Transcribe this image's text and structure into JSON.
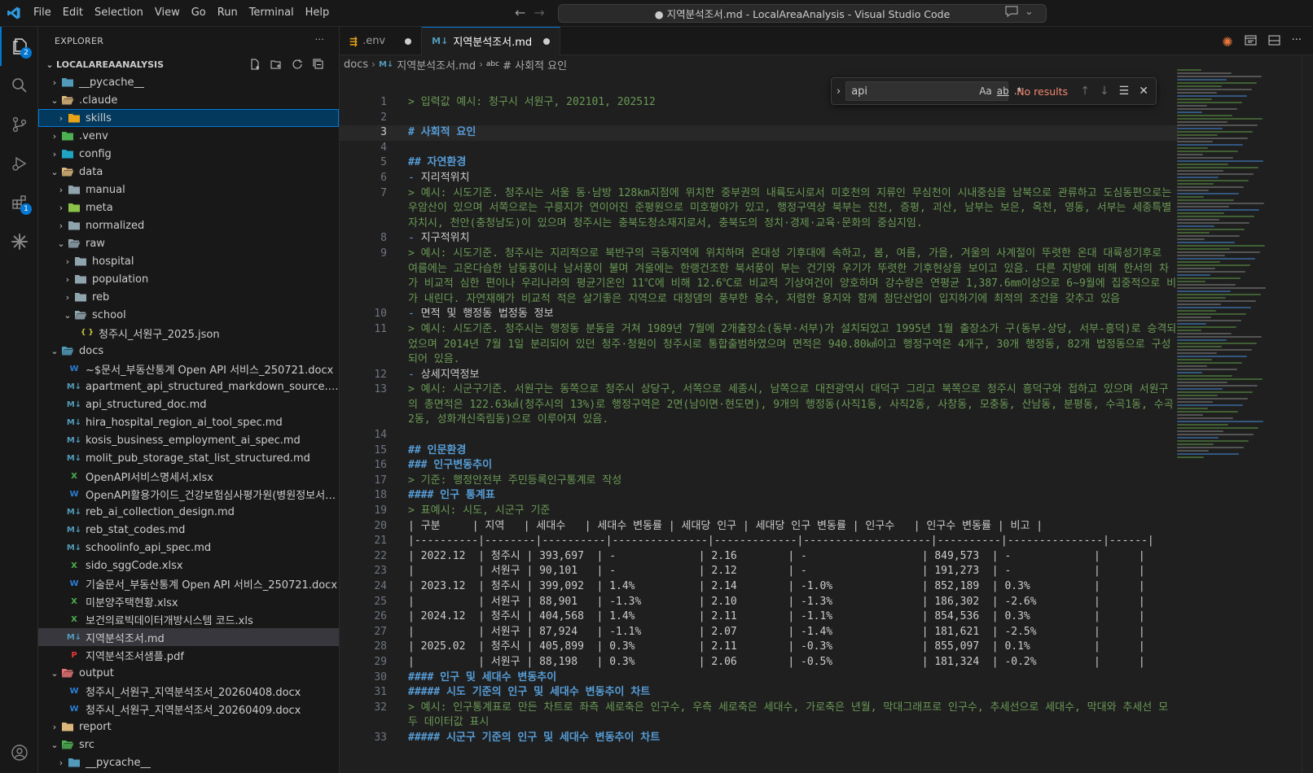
{
  "menu": [
    "File",
    "Edit",
    "Selection",
    "View",
    "Go",
    "Run",
    "Terminal",
    "Help"
  ],
  "window_title": "● 지역분석조서.md - LocalAreaAnalysis - Visual Studio Code",
  "activity": {
    "explorer_badge": "2",
    "extensions_badge": "1"
  },
  "explorer": {
    "header": "EXPLORER",
    "root": "LOCALAREAANALYSIS",
    "rows": [
      {
        "label": "__pycache__",
        "depth": 0,
        "type": "folder",
        "open": false,
        "color": "#519aba"
      },
      {
        "label": ".claude",
        "depth": 0,
        "type": "folder",
        "open": true,
        "color": "#dcb67a"
      },
      {
        "label": "skills",
        "depth": 1,
        "type": "folder",
        "open": false,
        "color": "#e8a317",
        "selected": true
      },
      {
        "label": ".venv",
        "depth": 0,
        "type": "folder",
        "open": false,
        "color": "#4caf50"
      },
      {
        "label": "config",
        "depth": 0,
        "type": "folder",
        "open": false,
        "color": "#20a4c4"
      },
      {
        "label": "data",
        "depth": 0,
        "type": "folder",
        "open": true,
        "color": "#dcb67a"
      },
      {
        "label": "manual",
        "depth": 1,
        "type": "folder",
        "open": false,
        "color": "#90a4ae"
      },
      {
        "label": "meta",
        "depth": 1,
        "type": "folder",
        "open": false,
        "color": "#8bc34a"
      },
      {
        "label": "normalized",
        "depth": 1,
        "type": "folder",
        "open": false,
        "color": "#90a4ae"
      },
      {
        "label": "raw",
        "depth": 1,
        "type": "folder",
        "open": true,
        "color": "#90a4ae"
      },
      {
        "label": "hospital",
        "depth": 2,
        "type": "folder",
        "open": false,
        "color": "#90a4ae"
      },
      {
        "label": "population",
        "depth": 2,
        "type": "folder",
        "open": false,
        "color": "#90a4ae"
      },
      {
        "label": "reb",
        "depth": 2,
        "type": "folder",
        "open": false,
        "color": "#90a4ae"
      },
      {
        "label": "school",
        "depth": 2,
        "type": "folder",
        "open": true,
        "color": "#90a4ae"
      },
      {
        "label": "청주시_서원구_2025.json",
        "depth": 3,
        "type": "json"
      },
      {
        "label": "docs",
        "depth": 0,
        "type": "folder",
        "open": true,
        "color": "#519aba"
      },
      {
        "label": "~$문서_부동산통계 Open API 서비스_250721.docx",
        "depth": 1,
        "type": "docx"
      },
      {
        "label": "apartment_api_structured_markdown_source.md",
        "depth": 1,
        "type": "md"
      },
      {
        "label": "api_structured_doc.md",
        "depth": 1,
        "type": "md"
      },
      {
        "label": "hira_hospital_region_ai_tool_spec.md",
        "depth": 1,
        "type": "md"
      },
      {
        "label": "kosis_business_employment_ai_spec.md",
        "depth": 1,
        "type": "md"
      },
      {
        "label": "molit_pub_storage_stat_list_structured.md",
        "depth": 1,
        "type": "md"
      },
      {
        "label": "OpenAPI서비스명세서.xlsx",
        "depth": 1,
        "type": "xlsx"
      },
      {
        "label": "OpenAPI활용가이드_건강보험심사평가원(병원정보서비...",
        "depth": 1,
        "type": "docx"
      },
      {
        "label": "reb_ai_collection_design.md",
        "depth": 1,
        "type": "md"
      },
      {
        "label": "reb_stat_codes.md",
        "depth": 1,
        "type": "md"
      },
      {
        "label": "schoolinfo_api_spec.md",
        "depth": 1,
        "type": "md"
      },
      {
        "label": "sido_sggCode.xlsx",
        "depth": 1,
        "type": "xlsx"
      },
      {
        "label": "기술문서_부동산통계 Open API 서비스_250721.docx",
        "depth": 1,
        "type": "docx"
      },
      {
        "label": "미분양주택현황.xlsx",
        "depth": 1,
        "type": "xlsx"
      },
      {
        "label": "보건의료빅데이터개방시스템 코드.xls",
        "depth": 1,
        "type": "xlsx"
      },
      {
        "label": "지역분석조서.md",
        "depth": 1,
        "type": "md",
        "current": true
      },
      {
        "label": "지역분석조서샘플.pdf",
        "depth": 1,
        "type": "pdf"
      },
      {
        "label": "output",
        "depth": 0,
        "type": "folder",
        "open": true,
        "color": "#e57373"
      },
      {
        "label": "청주시_서원구_지역분석조서_20260408.docx",
        "depth": 1,
        "type": "docx"
      },
      {
        "label": "청주시_서원구_지역분석조서_20260409.docx",
        "depth": 1,
        "type": "docx"
      },
      {
        "label": "report",
        "depth": 0,
        "type": "folder",
        "open": false,
        "color": "#dcb67a"
      },
      {
        "label": "src",
        "depth": 0,
        "type": "folder",
        "open": true,
        "color": "#4caf50"
      },
      {
        "label": "__pycache__",
        "depth": 1,
        "type": "folder",
        "open": false,
        "color": "#519aba"
      }
    ]
  },
  "tabs": [
    {
      "label": ".env",
      "icon": "env",
      "active": false,
      "dirty": true
    },
    {
      "label": "지역분석조서.md",
      "icon": "md",
      "active": true,
      "dirty": true
    }
  ],
  "breadcrumb": [
    "docs",
    "지역분석조서.md",
    "# 사회적 요인"
  ],
  "find": {
    "value": "api",
    "status": "No results"
  },
  "code_lines": [
    {
      "n": "1",
      "parts": [
        [
          "q",
          "> 입력값 예시: 청구시 서원구, 202101, 202512"
        ]
      ]
    },
    {
      "n": "2",
      "parts": [
        [
          "p",
          ""
        ]
      ]
    },
    {
      "n": "3",
      "parts": [
        [
          "h",
          "# 사회적 요인"
        ]
      ],
      "current": true
    },
    {
      "n": "4",
      "parts": [
        [
          "p",
          ""
        ]
      ]
    },
    {
      "n": "5",
      "parts": [
        [
          "h",
          "## 자연환경"
        ]
      ]
    },
    {
      "n": "6",
      "parts": [
        [
          "b",
          "- "
        ],
        [
          "p",
          "지리적위치"
        ]
      ]
    },
    {
      "n": "7",
      "parts": [
        [
          "q",
          "> 예시: 시도기준. 청주시는 서울 동·남방 128km지점에 위치한 중부권의 내륙도시로서 미호천의 지류인 무심천이 시내중심을 남북으로 관류하고 도심동편으로는 우암산이 있으며 서쪽으로는 구릉지가 연이어진 준평원으로 미호평야가 있고, 행정구역상 북부는 진천, 증평, 괴산, 남부는 보은, 옥천, 영동, 서부는 세종특별자치시, 천안(충청남도)이 있으며 청주시는 충북도청소재지로서, 충북도의 정치·경제·교육·문화의 중심지임."
        ]
      ]
    },
    {
      "n": "8",
      "parts": [
        [
          "b",
          "- "
        ],
        [
          "p",
          "지구적위치"
        ]
      ]
    },
    {
      "n": "9",
      "parts": [
        [
          "q",
          "> 예시: 시도기준. 청주시는 지리적으로 북반구의 극동지역에 위치하며 온대성 기후대에 속하고, 봄, 여름, 가을, 겨울의 사계절이 뚜렷한 온대 대륙성기후로 여름에는 고온다습한 남동풍이나 남서풍이 불며 겨울에는 한랭건조한 북서풍이 부는 건기와 우기가 뚜렷한 기후현상을 보이고 있음. 다른 지방에 비해 한서의 차가 비교적 심한 편이나 우리나라의 평균기온인 11℃에 비해 12.6℃로 비교적 기상여건이 양호하며 강수량은 연평균 1,387.6㎜이상으로 6~9월에 집중적으로 비가 내린다. 자연재해가 비교적 적은 살기좋은 지역으로 대청댐의 풍부한 용수, 저렴한 용지와 함께 첨단산업이 입지하기에 최적의 조건을 갖추고 있음"
        ]
      ]
    },
    {
      "n": "10",
      "parts": [
        [
          "b",
          "- "
        ],
        [
          "p",
          "면적 및 행정동 법정동 정보"
        ]
      ]
    },
    {
      "n": "11",
      "parts": [
        [
          "q",
          "> 예시: 시도기준. 청주시는 행정동 분동을 거쳐 1989년 7월에 2개출장소(동부·서부)가 설치되었고 1995년 1월 출장소가 구(동부-상당, 서부-흥덕)로 승격되었으며 2014년 7월 1일 분리되어 있던 청주·청원이 청주시로 통합출범하였으며 면적은 940.80㎢이고 행정구역은 4개구, 30개 행정동, 82개 법정동으로 구성되어 있음."
        ]
      ]
    },
    {
      "n": "12",
      "parts": [
        [
          "b",
          "- "
        ],
        [
          "p",
          "상세지역정보"
        ]
      ]
    },
    {
      "n": "13",
      "parts": [
        [
          "q",
          "> 예시: 시군구기준. 서원구는 동쪽으로 청주시 상당구, 서쪽으로 세종시, 남쪽으로 대전광역시 대덕구 그리고 북쪽으로 청주시 흥덕구와 접하고 있으며 서원구의 총면적은 122.63㎢(청주시의 13%)로 행정구역은 2면(남이면·현도면), 9개의 행정동(사직1동, 사직2동, 사창동, 모충동, 산남동, 분평동, 수곡1동, 수곡2동, 성화개신죽림동)으로 이루어져 있음."
        ]
      ]
    },
    {
      "n": "14",
      "parts": [
        [
          "p",
          ""
        ]
      ]
    },
    {
      "n": "15",
      "parts": [
        [
          "h",
          "## 인문환경"
        ]
      ]
    },
    {
      "n": "16",
      "parts": [
        [
          "h",
          "### 인구변동추이"
        ]
      ]
    },
    {
      "n": "17",
      "parts": [
        [
          "q",
          "> 기준: 행정안전부 주민등록인구통계로 작성"
        ]
      ]
    },
    {
      "n": "18",
      "parts": [
        [
          "h",
          "#### 인구 통계표"
        ]
      ]
    },
    {
      "n": "19",
      "parts": [
        [
          "q",
          "> 표예시: 시도, 시군구 기준"
        ]
      ]
    },
    {
      "n": "20",
      "parts": [
        [
          "p",
          "| 구분     | 지역   | 세대수   | 세대수 변동률 | 세대당 인구 | 세대당 인구 변동률 | 인구수   | 인구수 변동률 | 비고 |"
        ]
      ]
    },
    {
      "n": "21",
      "parts": [
        [
          "p",
          "|----------|--------|----------|---------------|-------------|--------------------|----------|---------------|------|"
        ]
      ]
    },
    {
      "n": "22",
      "parts": [
        [
          "p",
          "| 2022.12  | 청주시 | 393,697  | -             | 2.16        | -                  | 849,573  | -             |      |"
        ]
      ]
    },
    {
      "n": "23",
      "parts": [
        [
          "p",
          "|          | 서원구 | 90,101   | -             | 2.12        | -                  | 191,273  | -             |      |"
        ]
      ]
    },
    {
      "n": "24",
      "parts": [
        [
          "p",
          "| 2023.12  | 청주시 | 399,092  | 1.4%          | 2.14        | -1.0%              | 852,189  | 0.3%          |      |"
        ]
      ]
    },
    {
      "n": "25",
      "parts": [
        [
          "p",
          "|          | 서원구 | 88,901   | -1.3%         | 2.10        | -1.3%              | 186,302  | -2.6%         |      |"
        ]
      ]
    },
    {
      "n": "26",
      "parts": [
        [
          "p",
          "| 2024.12  | 청주시 | 404,568  | 1.4%          | 2.11        | -1.1%              | 854,536  | 0.3%          |      |"
        ]
      ]
    },
    {
      "n": "27",
      "parts": [
        [
          "p",
          "|          | 서원구 | 87,924   | -1.1%         | 2.07        | -1.4%              | 181,621  | -2.5%         |      |"
        ]
      ]
    },
    {
      "n": "28",
      "parts": [
        [
          "p",
          "| 2025.02  | 청주시 | 405,899  | 0.3%          | 2.11        | -0.3%              | 855,097  | 0.1%          |      |"
        ]
      ]
    },
    {
      "n": "29",
      "parts": [
        [
          "p",
          "|          | 서원구 | 88,198   | 0.3%          | 2.06        | -0.5%              | 181,324  | -0.2%         |      |"
        ]
      ]
    },
    {
      "n": "30",
      "parts": [
        [
          "h",
          "#### 인구 및 세대수 변동추이"
        ]
      ]
    },
    {
      "n": "31",
      "parts": [
        [
          "h",
          "##### 시도 기준의 인구 및 세대수 변동추이 차트"
        ]
      ]
    },
    {
      "n": "32",
      "parts": [
        [
          "q",
          "> 예시: 인구통계표로 만든 차트로 좌측 세로축은 인구수, 우측 세로축은 세대수, 가로축은 년월, 막대그래프로 인구수, 추세선으로 세대수, 막대와 추세선 모두 데이터값 표시"
        ]
      ]
    },
    {
      "n": "33",
      "parts": [
        [
          "h",
          "##### 시군구 기준의 인구 및 세대수 변동추이 차트"
        ]
      ]
    }
  ],
  "colors": {
    "accent": "#0078d4",
    "quote": "#6a9955",
    "heading": "#569cd6"
  }
}
